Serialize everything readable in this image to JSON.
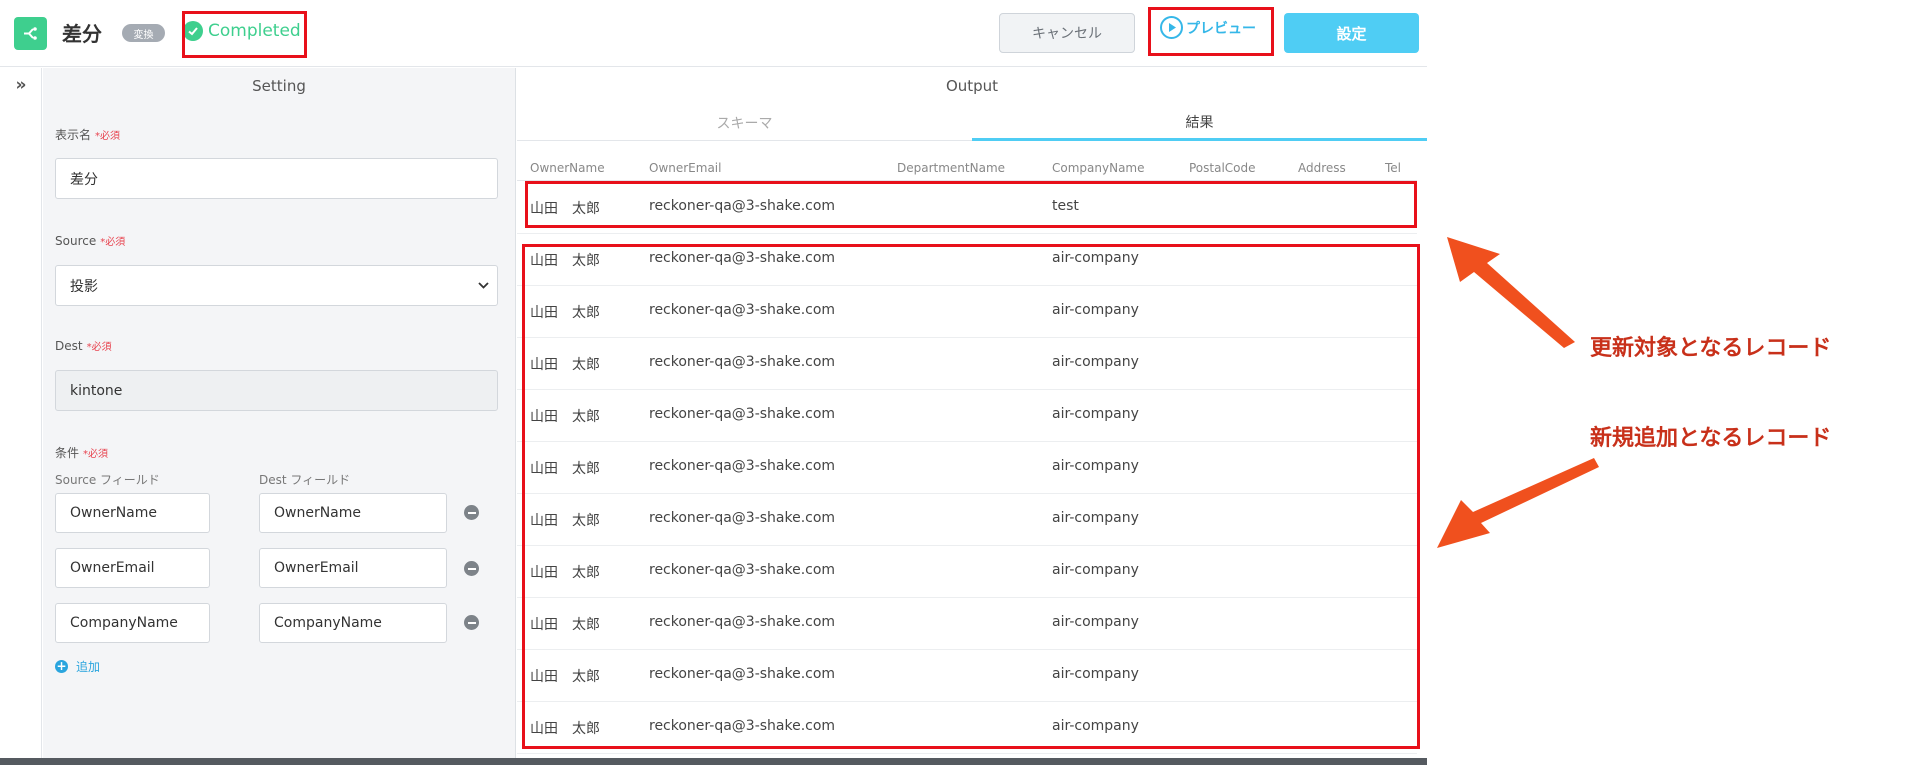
{
  "header": {
    "title": "差分",
    "type_badge": "変換",
    "status": "Completed",
    "cancel_label": "キャンセル",
    "preview_label": "プレビュー",
    "settings_label": "設定"
  },
  "setting": {
    "panel_title": "Setting",
    "required_mark": "*必須",
    "display_name": {
      "label": "表示名",
      "value": "差分"
    },
    "source": {
      "label": "Source",
      "value": "投影"
    },
    "dest": {
      "label": "Dest",
      "value": "kintone"
    },
    "conditions": {
      "label": "条件",
      "source_field_label": "Source フィールド",
      "dest_field_label": "Dest フィールド",
      "rows": [
        {
          "source": "OwnerName",
          "dest": "OwnerName"
        },
        {
          "source": "OwnerEmail",
          "dest": "OwnerEmail"
        },
        {
          "source": "CompanyName",
          "dest": "CompanyName"
        }
      ],
      "add_label": "追加"
    }
  },
  "output": {
    "panel_title": "Output",
    "tabs": [
      {
        "label": "スキーマ",
        "active": false
      },
      {
        "label": "結果",
        "active": true
      }
    ],
    "columns": [
      "OwnerName",
      "OwnerEmail",
      "DepartmentName",
      "CompanyName",
      "PostalCode",
      "Address",
      "Tel"
    ],
    "rows": [
      {
        "owner": "山田　太郎",
        "email": "reckoner-qa@3-shake.com",
        "company": "test"
      },
      {
        "owner": "山田　太郎",
        "email": "reckoner-qa@3-shake.com",
        "company": "air-company"
      },
      {
        "owner": "山田　太郎",
        "email": "reckoner-qa@3-shake.com",
        "company": "air-company"
      },
      {
        "owner": "山田　太郎",
        "email": "reckoner-qa@3-shake.com",
        "company": "air-company"
      },
      {
        "owner": "山田　太郎",
        "email": "reckoner-qa@3-shake.com",
        "company": "air-company"
      },
      {
        "owner": "山田　太郎",
        "email": "reckoner-qa@3-shake.com",
        "company": "air-company"
      },
      {
        "owner": "山田　太郎",
        "email": "reckoner-qa@3-shake.com",
        "company": "air-company"
      },
      {
        "owner": "山田　太郎",
        "email": "reckoner-qa@3-shake.com",
        "company": "air-company"
      },
      {
        "owner": "山田　太郎",
        "email": "reckoner-qa@3-shake.com",
        "company": "air-company"
      },
      {
        "owner": "山田　太郎",
        "email": "reckoner-qa@3-shake.com",
        "company": "air-company"
      },
      {
        "owner": "山田　太郎",
        "email": "reckoner-qa@3-shake.com",
        "company": "air-company"
      }
    ]
  },
  "annotations": {
    "update_caption": "更新対象となるレコード",
    "new_caption": "新規追加となるレコード",
    "highlight_color": "#e8101a",
    "arrow_color": "#f0501e"
  },
  "colors": {
    "accent_green": "#3ecf8e",
    "accent_blue": "#4fcdf4",
    "required_red": "#e8434f"
  }
}
